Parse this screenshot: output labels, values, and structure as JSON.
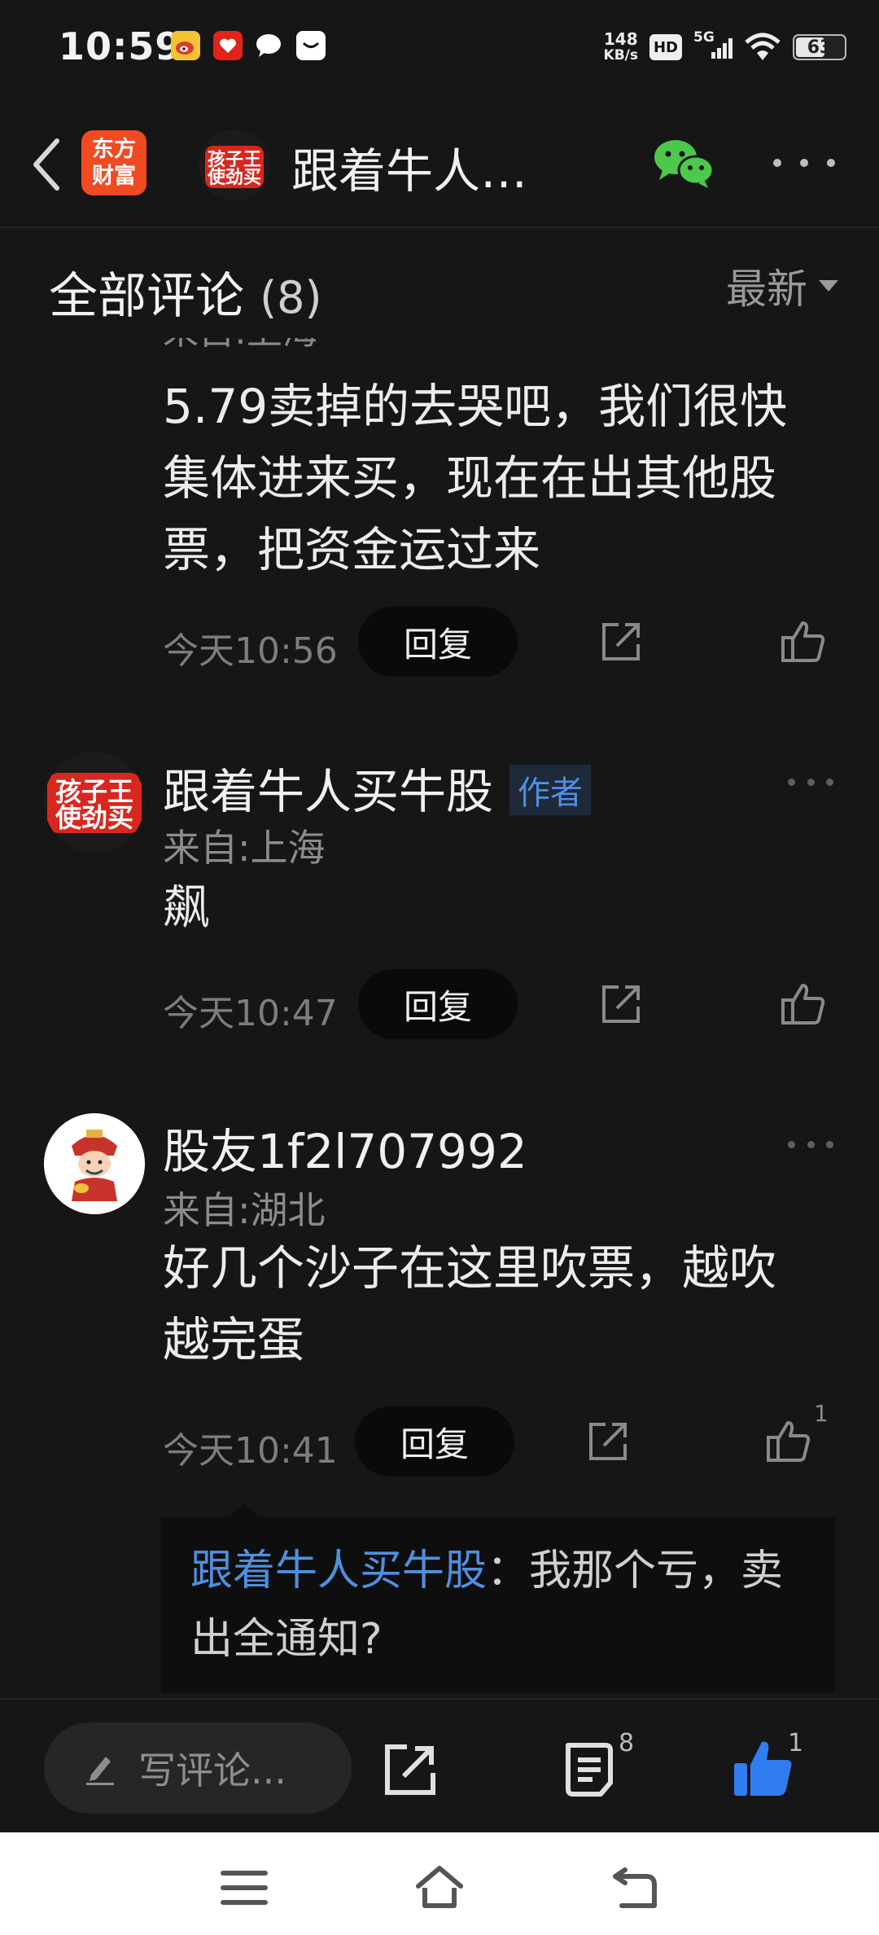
{
  "status_bar": {
    "time": "10:59",
    "net_speed_value": "148",
    "net_speed_unit": "KB/s",
    "hd_label": "HD",
    "signal_label": "5G",
    "battery_percent": 63,
    "battery_label": "63"
  },
  "header": {
    "brand_line1": "东方",
    "brand_line2": "财富",
    "avatar_text_line1": "孩子王",
    "avatar_text_line2": "使劲买",
    "title": "跟着牛人…"
  },
  "comments_section": {
    "title": "全部评论",
    "count": "(8)",
    "sort_label": "最新"
  },
  "comments": [
    {
      "location": "来自:上海",
      "text": "5.79卖掉的去哭吧，我们很快集体进来买，现在在出其他股票，把资金运过来",
      "time": "今天10:56",
      "reply_label": "回复"
    },
    {
      "username": "跟着牛人买牛股",
      "author_tag": "作者",
      "avatar_text_line1": "孩子王",
      "avatar_text_line2": "使劲买",
      "location": "来自:上海",
      "text": "飙",
      "time": "今天10:47",
      "reply_label": "回复"
    },
    {
      "username": "股友1f2l707992",
      "location": "来自:湖北",
      "text": "好几个沙子在这里吹票，越吹越完蛋",
      "time": "今天10:41",
      "reply_label": "回复",
      "like_count": "1",
      "sub_reply": {
        "name": "跟着牛人买牛股",
        "text": "：我那个亏，卖出全通知?"
      }
    }
  ],
  "bottom_bar": {
    "input_placeholder": "写评论...",
    "comment_count": "8",
    "like_count": "1"
  },
  "colors": {
    "background": "#161616",
    "accent_blue": "#4f8fe0",
    "brand_orange": "#f04a23",
    "like_blue": "#2f7df0",
    "wechat_green": "#4cc94a"
  }
}
